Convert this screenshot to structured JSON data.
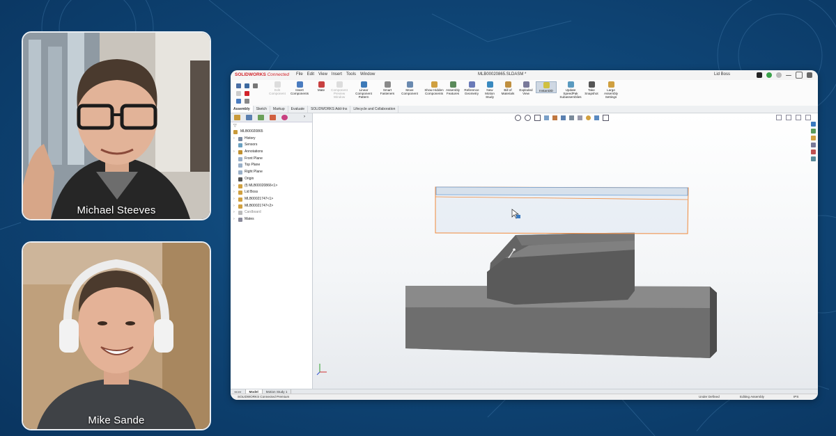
{
  "participants": [
    {
      "name": "Michael Steeves"
    },
    {
      "name": "Mike Sande"
    }
  ],
  "app": {
    "brand": "SOLIDWORKS",
    "brand_suffix": "Connected",
    "menus": [
      "File",
      "Edit",
      "View",
      "Insert",
      "Tools",
      "Window"
    ],
    "document_title": "MLB00020865.SLDASM *",
    "search_text": "Lid Boss"
  },
  "ribbon": {
    "buttons": [
      {
        "label": "Edit Component",
        "icon": "edit-component-icon",
        "disabled": true
      },
      {
        "label": "Insert Components",
        "icon": "insert-components-icon"
      },
      {
        "label": "Mate",
        "icon": "mate-icon"
      },
      {
        "label": "Component Preview Window",
        "icon": "preview-window-icon",
        "disabled": true
      },
      {
        "label": "Linear Component Pattern",
        "icon": "linear-pattern-icon"
      },
      {
        "label": "Smart Fasteners",
        "icon": "smart-fasteners-icon"
      },
      {
        "label": "Move Component",
        "icon": "move-component-icon"
      },
      {
        "label": "Show Hidden Components",
        "icon": "show-hidden-icon"
      },
      {
        "label": "Assembly Features",
        "icon": "assembly-features-icon"
      },
      {
        "label": "Reference Geometry",
        "icon": "reference-geometry-icon"
      },
      {
        "label": "New Motion Study",
        "icon": "motion-study-icon"
      },
      {
        "label": "Bill of Materials",
        "icon": "bom-icon"
      },
      {
        "label": "Exploded View",
        "icon": "exploded-view-icon"
      },
      {
        "label": "Instant3D",
        "icon": "instant3d-icon",
        "active": true
      },
      {
        "label": "Update SpeedPak Subassemblies",
        "icon": "speedpak-icon"
      },
      {
        "label": "Take Snapshot",
        "icon": "snapshot-icon"
      },
      {
        "label": "Large Assembly Settings",
        "icon": "large-assembly-icon"
      }
    ]
  },
  "command_tabs": [
    "Assembly",
    "Sketch",
    "Markup",
    "Evaluate",
    "SOLIDWORKS Add-Ins",
    "Lifecycle and Collaboration"
  ],
  "feature_tree": {
    "root": "MLB00020865",
    "items": [
      {
        "label": "History",
        "expandable": true,
        "icon": "history-icon"
      },
      {
        "label": "Sensors",
        "icon": "sensors-icon"
      },
      {
        "label": "Annotations",
        "expandable": true,
        "icon": "annotations-icon"
      },
      {
        "label": "Front Plane",
        "icon": "plane-icon"
      },
      {
        "label": "Top Plane",
        "icon": "plane-icon"
      },
      {
        "label": "Right Plane",
        "icon": "plane-icon"
      },
      {
        "label": "Origin",
        "icon": "origin-icon"
      },
      {
        "label": "(f) MLB00020866<1>",
        "expandable": true,
        "icon": "part-icon"
      },
      {
        "label": "Lid Boss",
        "expandable": true,
        "icon": "part-icon"
      },
      {
        "label": "MLB00021747<1>",
        "expandable": true,
        "icon": "part-icon"
      },
      {
        "label": "MLB00021747<2>",
        "expandable": true,
        "icon": "part-icon"
      },
      {
        "label": "Cardboard",
        "expandable": true,
        "icon": "folder-icon",
        "dim": true
      },
      {
        "label": "Mates",
        "expandable": true,
        "icon": "mates-icon"
      }
    ]
  },
  "bottom_tabs": [
    "Model",
    "Motion Study 1"
  ],
  "status_bar": {
    "product": "SOLIDWORKS Connected Premium",
    "state": "Under Defined",
    "mode": "Editing Assembly",
    "units": "IPS"
  },
  "colors": {
    "background": "#0f4677",
    "solidworks_red": "#d2232a",
    "selection_orange": "#f08a3c",
    "model_gray": "#6e6e6e"
  }
}
